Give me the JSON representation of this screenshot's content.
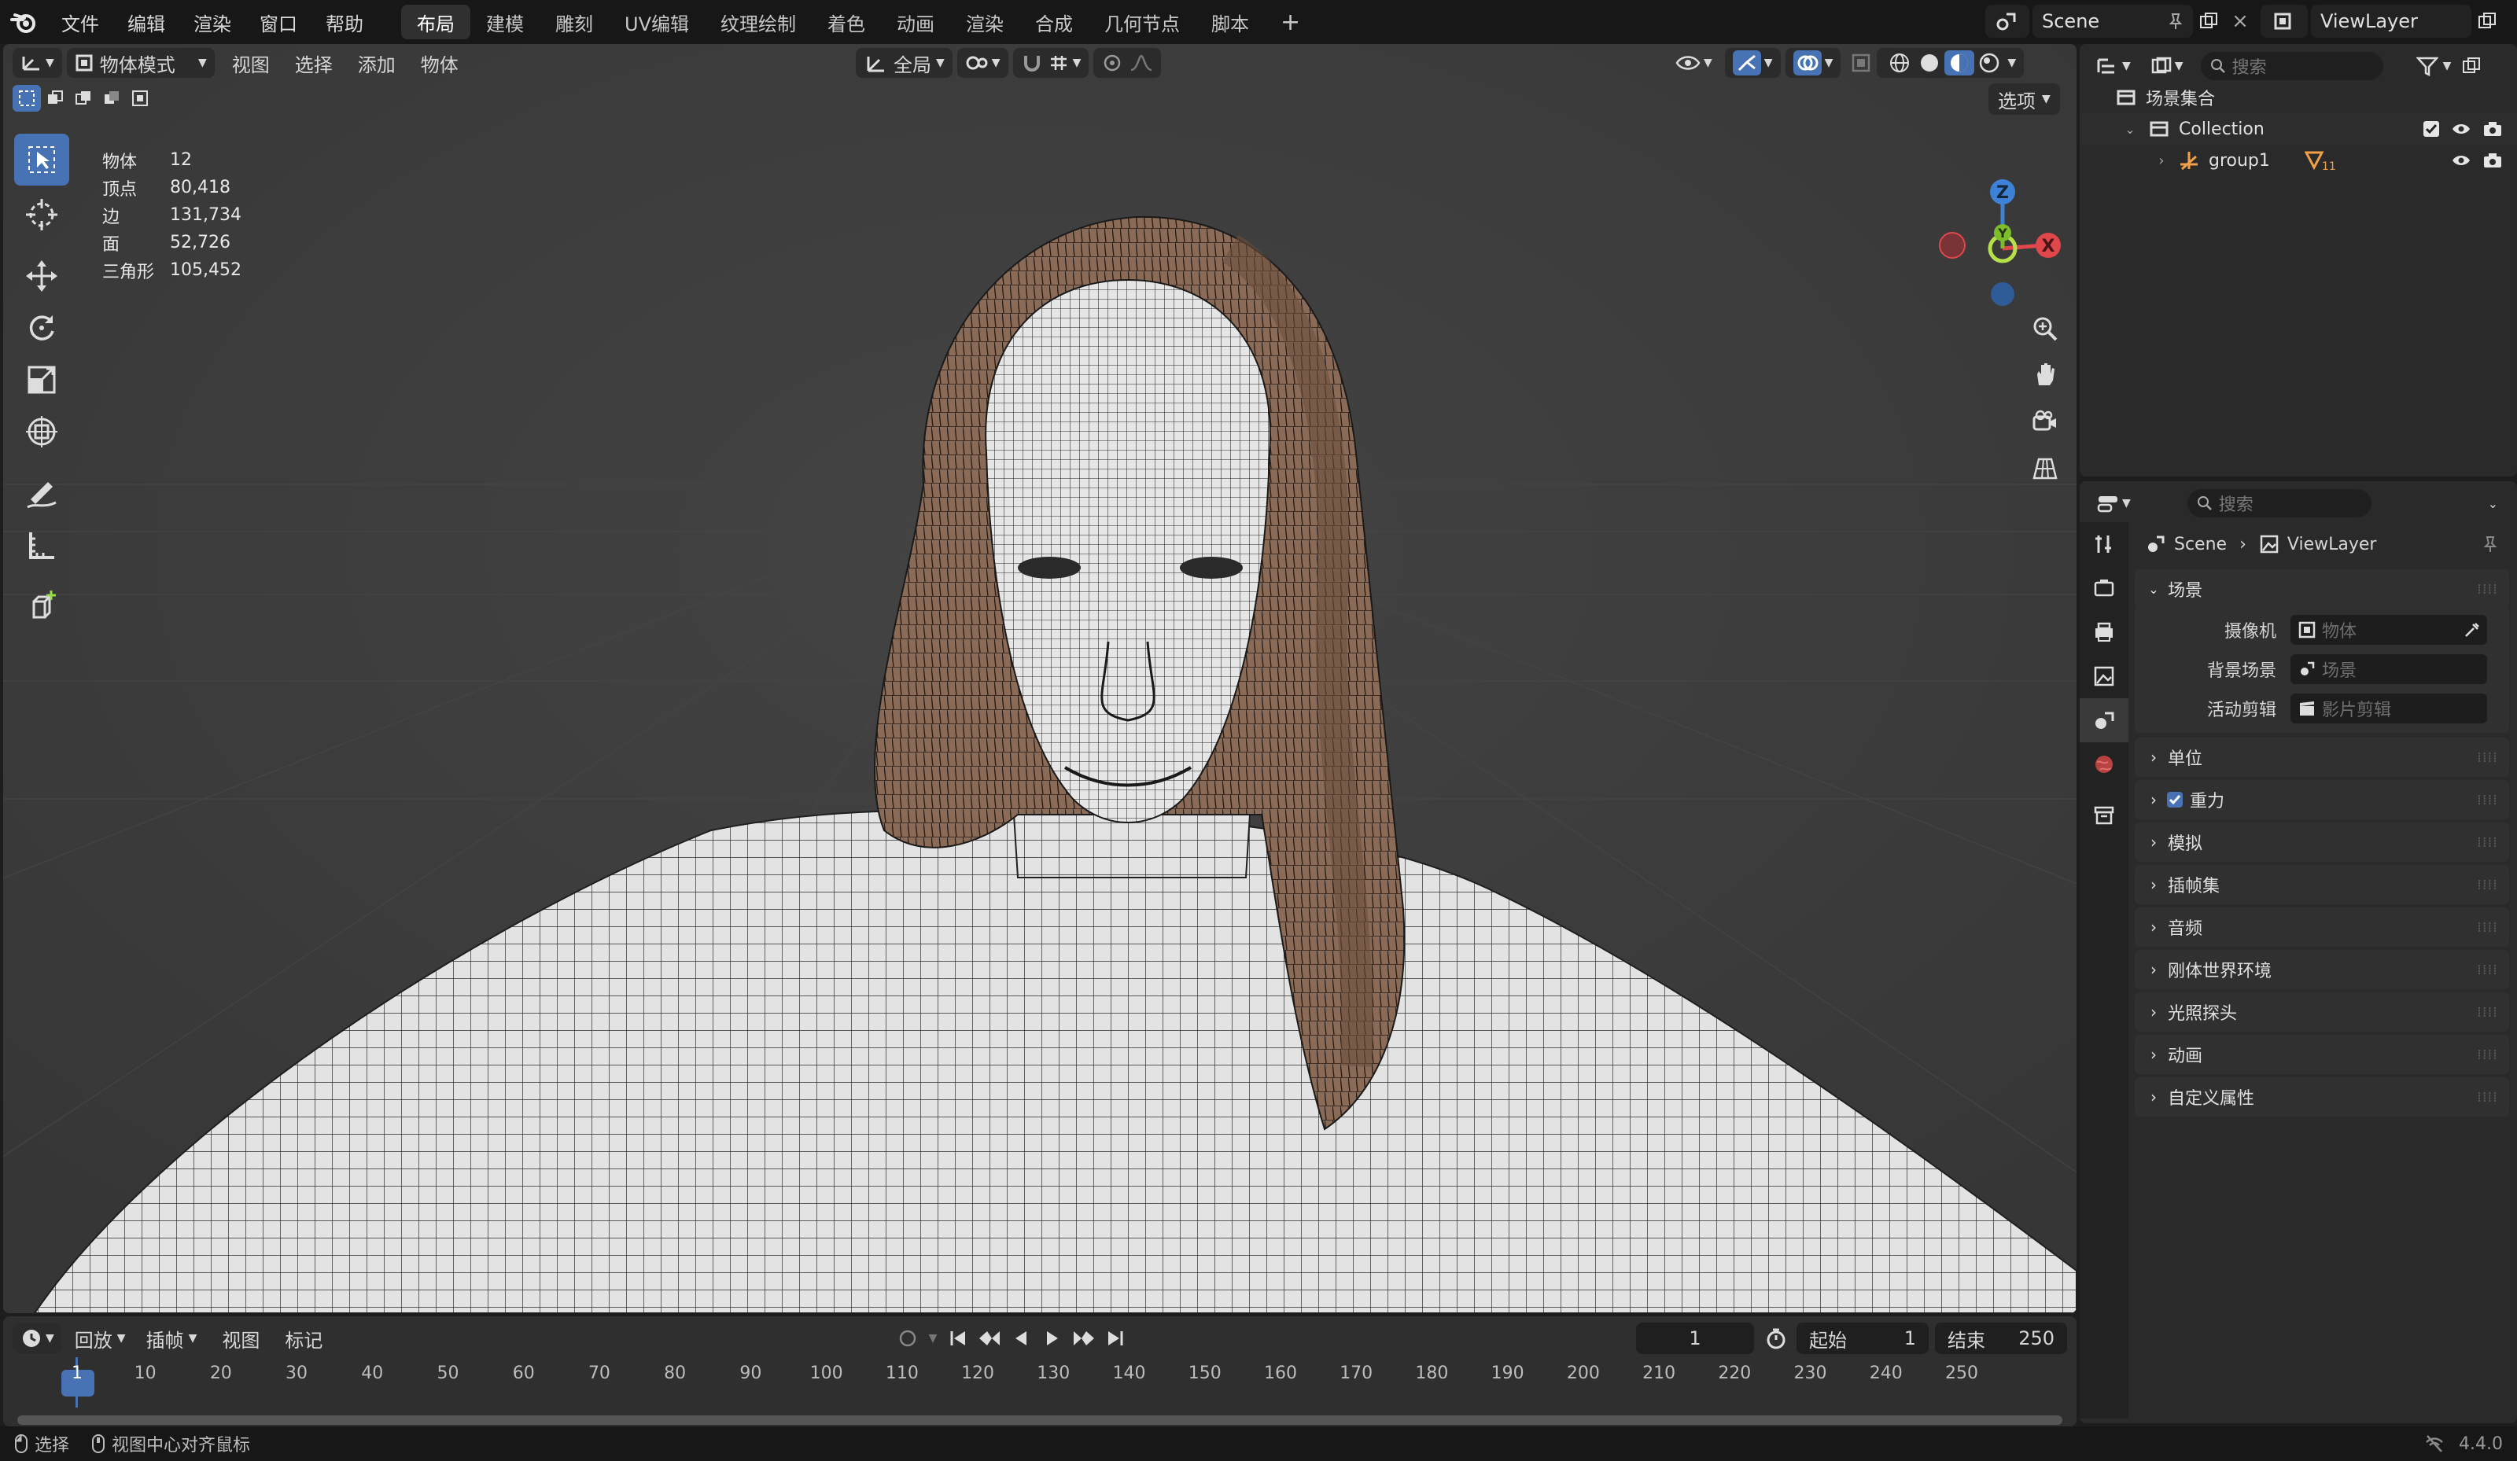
{
  "topbar": {
    "menus": [
      "文件",
      "编辑",
      "渲染",
      "窗口",
      "帮助"
    ],
    "workspaces": [
      "布局",
      "建模",
      "雕刻",
      "UV编辑",
      "纹理绘制",
      "着色",
      "动画",
      "渲染",
      "合成",
      "几何节点",
      "脚本"
    ],
    "active_workspace": "布局",
    "add_tab": "+",
    "scene_name": "Scene",
    "view_layer": "ViewLayer"
  },
  "viewport": {
    "mode": "物体模式",
    "menus": [
      "视图",
      "选择",
      "添加",
      "物体"
    ],
    "transform_orientation": "全局",
    "options_label": "选项",
    "stats": [
      {
        "label": "物体",
        "value": "12"
      },
      {
        "label": "顶点",
        "value": "80,418"
      },
      {
        "label": "边",
        "value": "131,734"
      },
      {
        "label": "面",
        "value": "52,726"
      },
      {
        "label": "三角形",
        "value": "105,452"
      }
    ],
    "gizmo": {
      "x": "X",
      "y": "Y",
      "z": "Z"
    },
    "colors": {
      "x": "#e0474b",
      "y": "#7dbd2c",
      "z": "#3d82d6",
      "bg": "#3b3b3b",
      "accent": "#4772b3"
    }
  },
  "timeline": {
    "menus": [
      "回放",
      "插帧",
      "视图",
      "标记"
    ],
    "current_frame": "1",
    "start_label": "起始",
    "start_value": "1",
    "end_label": "结束",
    "end_value": "250",
    "ticks": [
      "1",
      "10",
      "20",
      "30",
      "40",
      "50",
      "60",
      "70",
      "80",
      "90",
      "100",
      "110",
      "120",
      "130",
      "140",
      "150",
      "160",
      "170",
      "180",
      "190",
      "200",
      "210",
      "220",
      "230",
      "240",
      "250"
    ]
  },
  "statusbar": {
    "left": "选择",
    "middle": "视图中心对齐鼠标",
    "version": "4.4.0"
  },
  "outliner": {
    "search_placeholder": "搜索",
    "scene_collection": "场景集合",
    "collection": "Collection",
    "group": "group1",
    "group_badge": "11"
  },
  "properties": {
    "search_placeholder": "搜索",
    "breadcrumb_scene": "Scene",
    "breadcrumb_view_layer": "ViewLayer",
    "scene_panel": "场景",
    "fields": [
      {
        "label": "摄像机",
        "placeholder": "物体"
      },
      {
        "label": "背景场景",
        "placeholder": "场景"
      },
      {
        "label": "活动剪辑",
        "placeholder": "影片剪辑"
      }
    ],
    "panels": [
      "单位",
      "重力",
      "模拟",
      "插帧集",
      "音频",
      "刚体世界环境",
      "光照探头",
      "动画",
      "自定义属性"
    ],
    "gravity_checked": true
  }
}
